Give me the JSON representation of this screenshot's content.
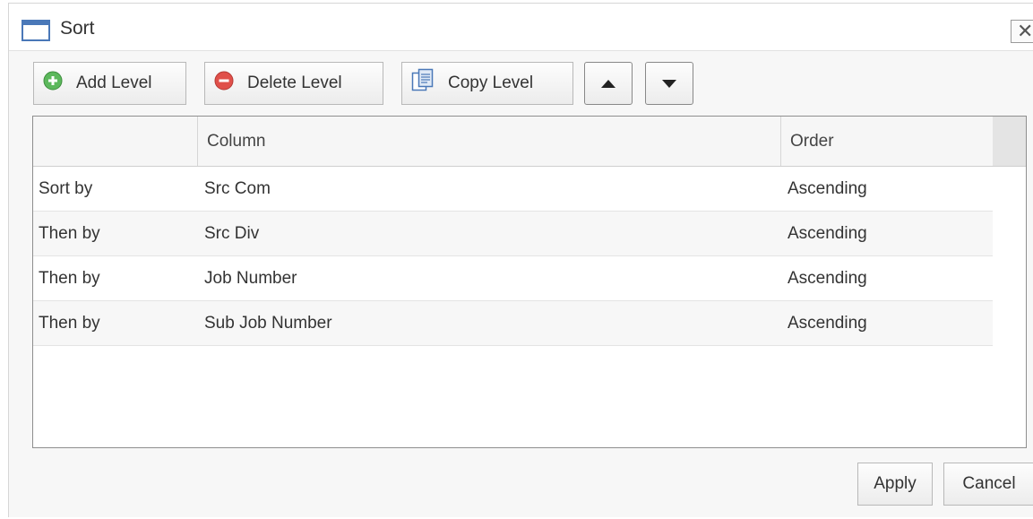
{
  "dialog": {
    "title": "Sort",
    "close_glyph": "✕"
  },
  "toolbar": {
    "add_label": "Add Level",
    "delete_label": "Delete Level",
    "copy_label": "Copy Level"
  },
  "icons": {
    "add": "plus-circle-icon",
    "delete": "minus-circle-icon",
    "copy": "copy-document-icon",
    "up": "triangle-up-icon",
    "down": "triangle-down-icon"
  },
  "colors": {
    "add_green": "#5cb85c",
    "delete_red": "#e0504a",
    "title_icon_blue": "#4a78b8"
  },
  "grid": {
    "headers": [
      "",
      "Column",
      "Order"
    ],
    "rows": [
      [
        "Sort by",
        "Src Com",
        "Ascending"
      ],
      [
        "Then by",
        "Src Div",
        "Ascending"
      ],
      [
        "Then by",
        "Job Number",
        "Ascending"
      ],
      [
        "Then by",
        "Sub Job Number",
        "Ascending"
      ]
    ]
  },
  "footer": {
    "apply_label": "Apply",
    "cancel_label": "Cancel"
  }
}
